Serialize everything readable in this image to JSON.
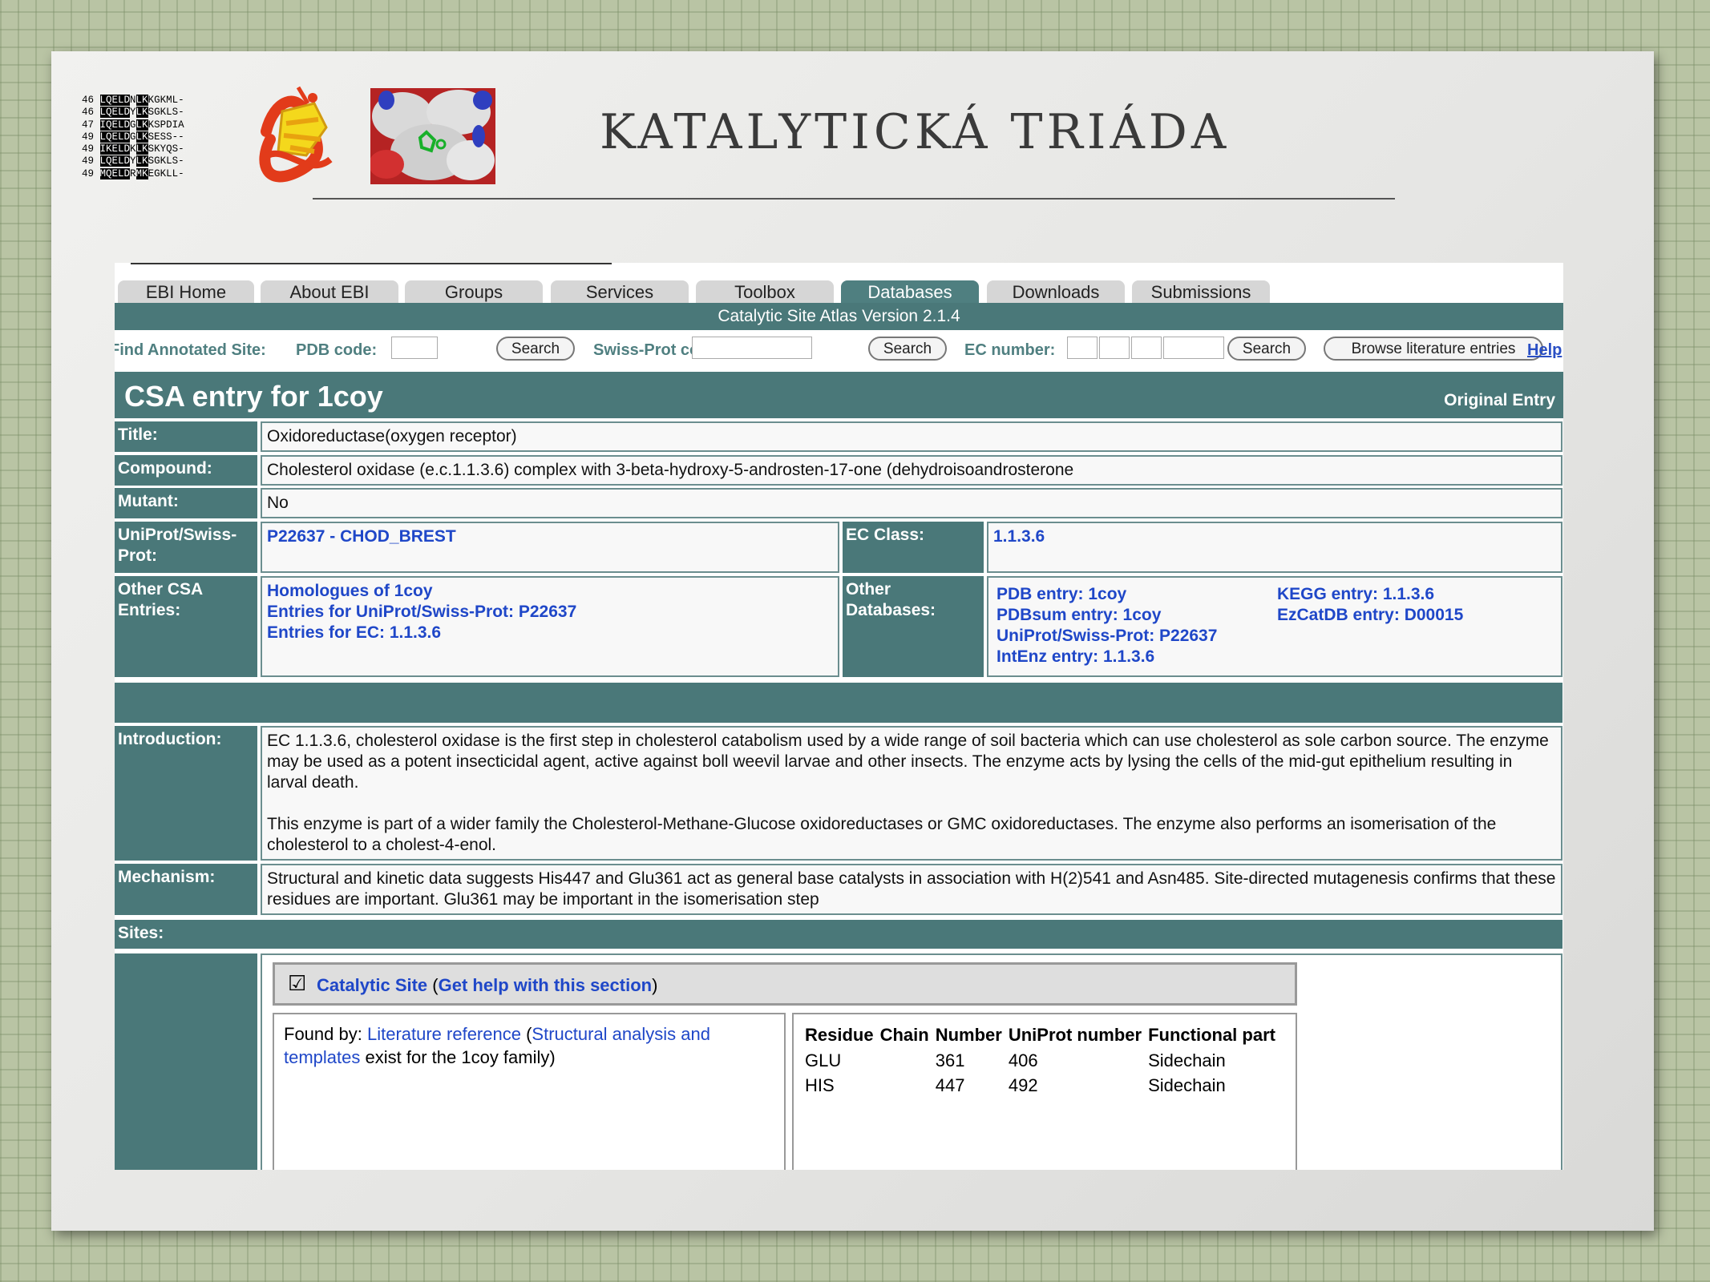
{
  "slide": {
    "title": "KATALYTICKÁ TRIÁDA",
    "sequence_rows": [
      {
        "num": "46",
        "hl": "LQELD",
        "mid": "N",
        "hl2": "LK",
        "rest": "KGKML-"
      },
      {
        "num": "46",
        "hl": "LQELD",
        "mid": "Y",
        "hl2": "LK",
        "rest": "SGKLS-"
      },
      {
        "num": "47",
        "hl": "IQELD",
        "mid": "G",
        "hl2": "LK",
        "rest": "KSPDIA"
      },
      {
        "num": "49",
        "hl": "LQELD",
        "mid": "G",
        "hl2": "LK",
        "rest": "SESS--"
      },
      {
        "num": "49",
        "hl": "IKELD",
        "mid": "K",
        "hl2": "LK",
        "rest": "SKYQS-"
      },
      {
        "num": "49",
        "hl": "LQELD",
        "mid": "Y",
        "hl2": "LK",
        "rest": "SGKLS-"
      },
      {
        "num": "49",
        "hl": "MQELD",
        "mid": "R",
        "hl2": "MK",
        "rest": "EGKLL-"
      }
    ]
  },
  "nav": {
    "tabs": [
      "EBI Home",
      "About EBI",
      "Groups",
      "Services",
      "Toolbox",
      "Databases",
      "Downloads",
      "Submissions"
    ],
    "active": "Databases",
    "banner": "Catalytic Site Atlas Version 2.1.4"
  },
  "search": {
    "find_label": "Find Annotated Site:",
    "pdb_label": "PDB code:",
    "swiss_label": "Swiss-Prot code:",
    "ec_label": "EC number:",
    "search_btn": "Search",
    "browse_btn": "Browse literature entries",
    "help": "Help"
  },
  "entry": {
    "heading": "CSA entry for 1coy",
    "original": "Original Entry",
    "title_label": "Title:",
    "title_value": "Oxidoreductase(oxygen receptor)",
    "compound_label": "Compound:",
    "compound_value": "Cholesterol oxidase (e.c.1.1.3.6) complex with 3-beta-hydroxy-5-androsten-17-one (dehydroisoandrosterone",
    "mutant_label": "Mutant:",
    "mutant_value": "No",
    "uniprot_label": "UniProt/Swiss-Prot:",
    "uniprot_value": "P22637 - CHOD_BREST",
    "ec_class_label": "EC Class:",
    "ec_class_value": "1.1.3.6",
    "other_csa_label": "Other CSA Entries:",
    "other_csa_links": [
      "Homologues of 1coy",
      "Entries for UniProt/Swiss-Prot: P22637",
      "Entries for EC: 1.1.3.6"
    ],
    "other_db_label": "Other Databases:",
    "other_db_links_left": [
      "PDB entry: 1coy",
      "PDBsum entry: 1coy",
      "UniProt/Swiss-Prot: P22637",
      "IntEnz entry: 1.1.3.6"
    ],
    "other_db_links_right": [
      "KEGG entry: 1.1.3.6",
      "EzCatDB entry: D00015"
    ],
    "intro_label": "Introduction:",
    "intro_p1": "EC 1.1.3.6, cholesterol oxidase is the first step in cholesterol catabolism used by a wide range of soil bacteria which can use cholesterol as sole carbon source. The enzyme may be used as a potent insecticidal agent, active against boll weevil larvae and other insects. The enzyme acts by lysing the cells of the mid-gut epithelium resulting in larval death.",
    "intro_p2": "This enzyme is part of a wider family the Cholesterol-Methane-Glucose oxidoreductases or GMC oxidoreductases. The enzyme also performs an isomerisation of the cholesterol to a cholest-4-enol.",
    "mech_label": "Mechanism:",
    "mech_value": "Structural and kinetic data suggests His447 and Glu361 act as general base catalysts in association with H(2)541 and Asn485. Site-directed mutagenesis confirms that these residues are important. Glu361 may be important in the isomerisation step",
    "sites_label": "Sites:"
  },
  "sites": {
    "checkbox_glyph": "☑",
    "catalytic_site": "Catalytic Site",
    "paren_open": "(",
    "help_link": "Get help with this section",
    "paren_close": ")",
    "found_by": "Found by:",
    "lit_ref": "Literature reference",
    "struct_link": "Structural analysis and templates",
    "exist_text": "exist for the 1coy family)",
    "columns": [
      "Residue",
      "Chain",
      "Number",
      "UniProt number",
      "Functional part"
    ],
    "rows": [
      [
        "GLU",
        "",
        "361",
        "406",
        "Sidechain"
      ],
      [
        "HIS",
        "",
        "447",
        "492",
        "Sidechain"
      ]
    ]
  }
}
